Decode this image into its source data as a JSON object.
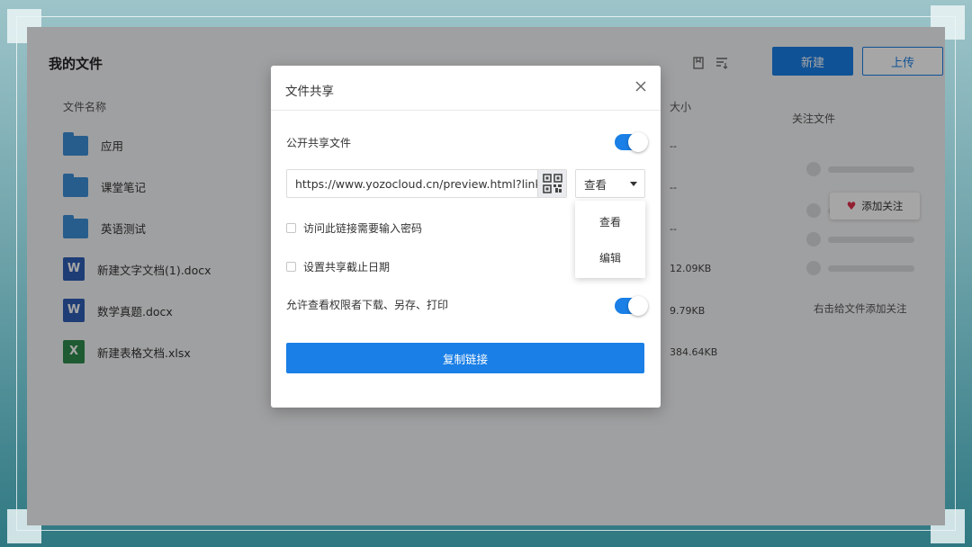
{
  "app": {
    "title": "我的文件",
    "new_label": "新建",
    "upload_label": "上传",
    "accent_color": "#1a7fe6"
  },
  "file_list": {
    "col_name": "文件名称",
    "col_size": "大小",
    "items": [
      {
        "name": "应用",
        "type": "folder",
        "size": "--"
      },
      {
        "name": "课堂笔记",
        "type": "folder",
        "size": "--"
      },
      {
        "name": "英语测试",
        "type": "folder",
        "size": "--"
      },
      {
        "name": "新建文字文档(1).docx",
        "type": "word",
        "size": "12.09KB",
        "icon_letter": "W"
      },
      {
        "name": "数学真题.docx",
        "type": "word",
        "size": "9.79KB",
        "icon_letter": "W"
      },
      {
        "name": "新建表格文档.xlsx",
        "type": "excel",
        "size": "384.64KB",
        "icon_letter": "X"
      }
    ]
  },
  "right_panel": {
    "title": "关注文件",
    "follow_label": "添加关注",
    "hint": "右击给文件添加关注"
  },
  "modal": {
    "title": "文件共享",
    "public_share_label": "公开共享文件",
    "public_share_on": true,
    "link_url": "https://www.yozocloud.cn/preview.html?linksh",
    "permission_selected": "查看",
    "permission_options": [
      "查看",
      "编辑"
    ],
    "password_label": "访问此链接需要输入密码",
    "password_checked": false,
    "expiry_label": "设置共享截止日期",
    "expiry_checked": false,
    "allow_download_label": "允许查看权限者下载、另存、打印",
    "allow_download_on": true,
    "copy_label": "复制链接"
  }
}
